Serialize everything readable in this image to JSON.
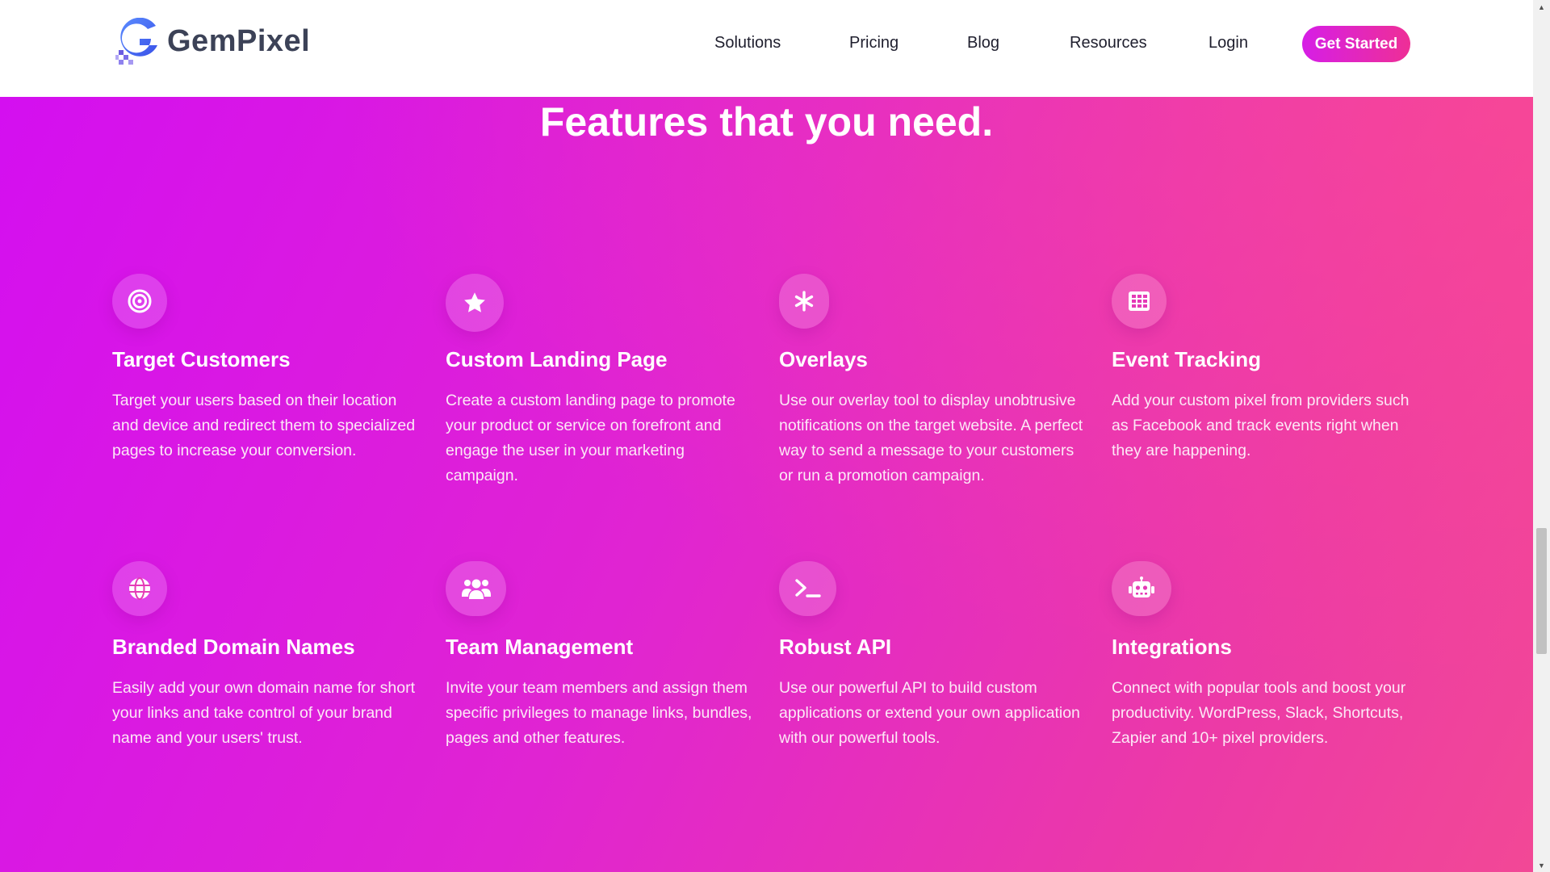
{
  "brand": {
    "name": "GemPixel",
    "colors": {
      "blue": "#4a6cf7",
      "text": "#3c4257",
      "accent": "#d61ee6"
    }
  },
  "nav": {
    "links": [
      "Solutions",
      "Pricing",
      "Blog",
      "Resources",
      "Login"
    ],
    "cta": "Get Started"
  },
  "features": {
    "title": "Features that you need.",
    "items": [
      {
        "icon": "target-icon",
        "title": "Target Customers",
        "description": "Target your users based on their location and device and redirect them to specialized pages to increase your conversion."
      },
      {
        "icon": "star-icon",
        "title": "Custom Landing Page",
        "description": "Create a custom landing page to promote your product or service on forefront and engage the user in your marketing campaign."
      },
      {
        "icon": "asterisk-icon",
        "title": "Overlays",
        "description": "Use our overlay tool to display unobtrusive notifications on the target website. A perfect way to send a message to your customers or run a promotion campaign."
      },
      {
        "icon": "grid-icon",
        "title": "Event Tracking",
        "description": "Add your custom pixel from providers such as Facebook and track events right when they are happening."
      },
      {
        "icon": "globe-icon",
        "title": "Branded Domain Names",
        "description": "Easily add your own domain name for short your links and take control of your brand name and your users' trust."
      },
      {
        "icon": "team-icon",
        "title": "Team Management",
        "description": "Invite your team members and assign them specific privileges to manage links, bundles, pages and other features."
      },
      {
        "icon": "terminal-icon",
        "title": "Robust API",
        "description": "Use our powerful API to build custom applications or extend your own application with our powerful tools."
      },
      {
        "icon": "robot-icon",
        "title": "Integrations",
        "description": "Connect with popular tools and boost your productivity. WordPress, Slack, Shortcuts, Zapier and 10+ pixel providers."
      }
    ]
  }
}
